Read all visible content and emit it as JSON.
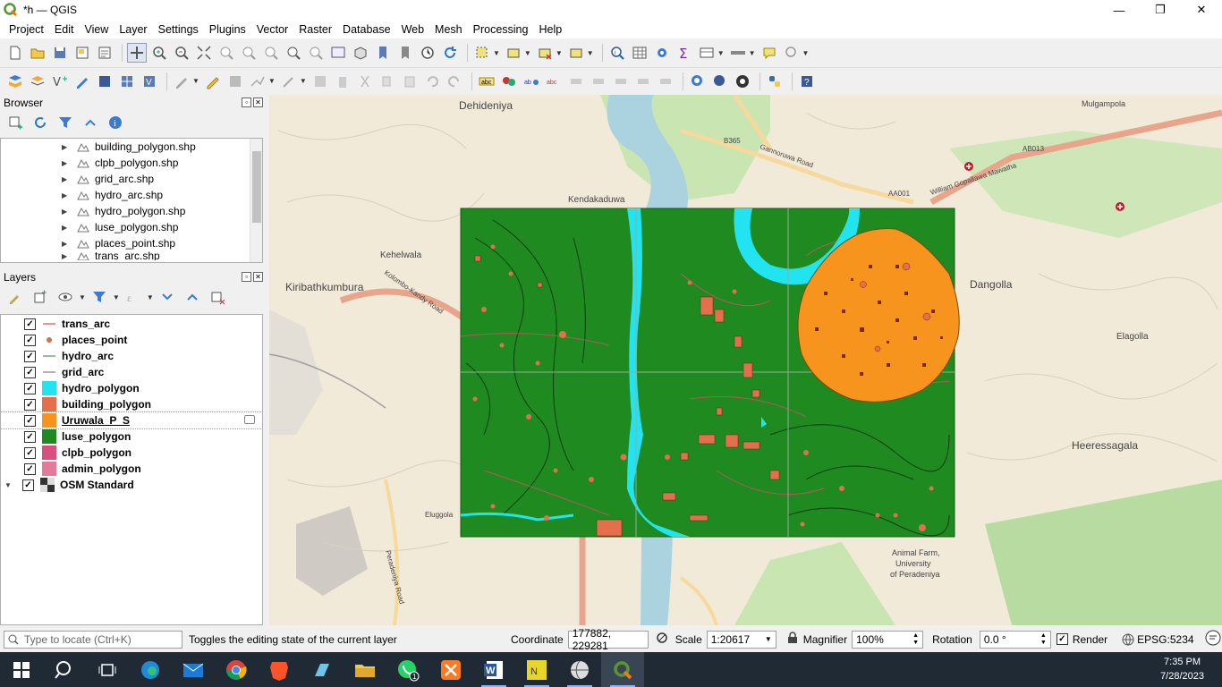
{
  "window": {
    "title": "*h — QGIS",
    "minimize": "—",
    "maximize": "❐",
    "close": "✕"
  },
  "menus": [
    "Project",
    "Edit",
    "View",
    "Layer",
    "Settings",
    "Plugins",
    "Vector",
    "Raster",
    "Database",
    "Web",
    "Mesh",
    "Processing",
    "Help"
  ],
  "browser": {
    "title": "Browser",
    "items": [
      {
        "label": "building_polygon.shp"
      },
      {
        "label": "clpb_polygon.shp"
      },
      {
        "label": "grid_arc.shp"
      },
      {
        "label": "hydro_arc.shp"
      },
      {
        "label": "hydro_polygon.shp"
      },
      {
        "label": "luse_polygon.shp"
      },
      {
        "label": "places_point.shp"
      },
      {
        "label": "trans_arc.shp"
      }
    ]
  },
  "layers": {
    "title": "Layers",
    "items": [
      {
        "label": "trans_arc",
        "symbol": "line",
        "color": "#e07070",
        "checked": "✓"
      },
      {
        "label": "places_point",
        "symbol": "point",
        "color": "#d4704a",
        "checked": "✓"
      },
      {
        "label": "hydro_arc",
        "symbol": "line",
        "color": "#6ab06a",
        "checked": "✓"
      },
      {
        "label": "grid_arc",
        "symbol": "line",
        "color": "#9a9a9a",
        "checked": "✓"
      },
      {
        "label": "hydro_polygon",
        "symbol": "fill",
        "color": "#22e3f0",
        "checked": "✓"
      },
      {
        "label": "building_polygon",
        "symbol": "fill",
        "color": "#e46f4d",
        "checked": "✓"
      },
      {
        "label": "Uruwala_P_S",
        "symbol": "fill",
        "color": "#f7941d",
        "checked": "✓"
      },
      {
        "label": "luse_polygon",
        "symbol": "fill",
        "color": "#1f8a1f",
        "checked": "✓"
      },
      {
        "label": "clpb_polygon",
        "symbol": "fill",
        "color": "#d94f7d",
        "checked": "✓"
      },
      {
        "label": "admin_polygon",
        "symbol": "fill",
        "color": "#e47a9a",
        "checked": "✓"
      },
      {
        "label": "OSM Standard",
        "symbol": "raster",
        "color": "#333333",
        "checked": "✓"
      }
    ]
  },
  "map": {
    "labels": [
      {
        "text": "Dehideniya"
      },
      {
        "text": "Kiribathkumbura"
      },
      {
        "text": "Dangolla"
      },
      {
        "text": "Elagolla"
      },
      {
        "text": "Heeressagala"
      },
      {
        "text": "Kendakaduwa"
      },
      {
        "text": "Kehelwala"
      },
      {
        "text": "Animal Farm,"
      },
      {
        "text": "University"
      },
      {
        "text": "of Peradeniya"
      },
      {
        "text": "Gannoruwa Road"
      },
      {
        "text": "Kolombo-Kandy Road"
      },
      {
        "text": "B365"
      },
      {
        "text": "AA001"
      },
      {
        "text": "AB013"
      },
      {
        "text": "Mulgampola"
      },
      {
        "text": "Eluggola"
      },
      {
        "text": "Peradeniya Road"
      },
      {
        "text": "William Gopallawa Mawatha"
      }
    ]
  },
  "status": {
    "locate_placeholder": "Type to locate (Ctrl+K)",
    "message": "Toggles the editing state of the current layer",
    "coordinate_label": "Coordinate",
    "coordinate_value": "177882, 229281",
    "scale_label": "Scale",
    "scale_value": "1:20617",
    "magnifier_label": "Magnifier",
    "magnifier_value": "100%",
    "rotation_label": "Rotation",
    "rotation_value": "0.0 °",
    "render_label": "Render",
    "crs": "EPSG:5234"
  },
  "taskbar": {
    "time": "7:35 PM",
    "date": "7/28/2023"
  },
  "colors": {
    "luse": "#1f8a1f",
    "water": "#22e3f0",
    "building": "#e46f4d",
    "buffer": "#f7941d"
  }
}
